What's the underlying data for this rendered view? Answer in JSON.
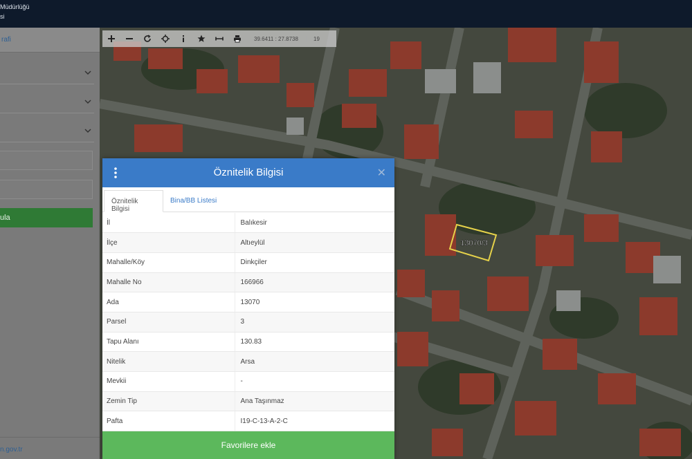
{
  "header": {
    "title_line1": "Müdürlüğü",
    "title_line2": "si"
  },
  "sidebar": {
    "heading": "rafi",
    "query_button": "ula",
    "footer_link": "n.gov.tr"
  },
  "map_toolbar": {
    "coordinates": "39.6411 : 27.8738",
    "zoom_level": "19"
  },
  "parcel_label": "13070/3",
  "popup": {
    "title": "Öznitelik Bilgisi",
    "tabs": [
      "Öznitelik Bilgisi",
      "Bina/BB Listesi"
    ],
    "rows": [
      {
        "key": "İl",
        "value": "Balıkesir"
      },
      {
        "key": "İlçe",
        "value": "Altıeylül"
      },
      {
        "key": "Mahalle/Köy",
        "value": "Dinkçiler"
      },
      {
        "key": "Mahalle No",
        "value": "166966"
      },
      {
        "key": "Ada",
        "value": "13070"
      },
      {
        "key": "Parsel",
        "value": "3"
      },
      {
        "key": "Tapu Alanı",
        "value": "130.83"
      },
      {
        "key": "Nitelik",
        "value": "Arsa"
      },
      {
        "key": "Mevkii",
        "value": "-"
      },
      {
        "key": "Zemin Tip",
        "value": "Ana Taşınmaz"
      },
      {
        "key": "Pafta",
        "value": "I19-C-13-A-2-C"
      }
    ],
    "favorite_button": "Favorilere ekle"
  },
  "colors": {
    "header_bg": "#0e1a2b",
    "popup_header": "#3a7bc8",
    "favorite_button": "#5cb85c",
    "query_button": "#2f7a35",
    "parcel_outline": "#e6d24a"
  }
}
